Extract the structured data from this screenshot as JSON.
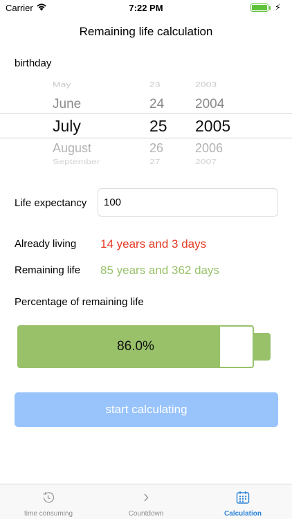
{
  "status_bar": {
    "carrier": "Carrier",
    "time": "7:22 PM"
  },
  "nav": {
    "title": "Remaining life calculation"
  },
  "birthday": {
    "label": "birthday",
    "picker": {
      "months": [
        "May",
        "June",
        "July",
        "August",
        "September"
      ],
      "days": [
        "23",
        "24",
        "25",
        "26",
        "27"
      ],
      "years": [
        "2003",
        "2004",
        "2005",
        "2006",
        "2007"
      ],
      "selected": {
        "month": "July",
        "day": "25",
        "year": "2005"
      }
    }
  },
  "expectancy": {
    "label": "Life expectancy",
    "value": "100"
  },
  "already_living": {
    "label": "Already living",
    "value": "14 years and 3 days",
    "color": "#e53a24"
  },
  "remaining_life": {
    "label": "Remaining life",
    "value": "85 years and 362 days",
    "color": "#98c16a"
  },
  "percentage": {
    "label": "Percentage of remaining life",
    "value_text": "86.0%",
    "fraction": 0.86,
    "color": "#98c16a"
  },
  "actions": {
    "start_label": "start calculating",
    "start_color": "#99c3fb"
  },
  "tabs": [
    {
      "label": "time consuming",
      "icon": "history-clock-icon",
      "active": false
    },
    {
      "label": "Countdown",
      "icon": "chevron-right-icon",
      "active": false
    },
    {
      "label": "Calculation",
      "icon": "calendar-icon",
      "active": true
    }
  ],
  "colors": {
    "tab_active": "#2a83d8",
    "tab_inactive": "#8e8e93"
  }
}
